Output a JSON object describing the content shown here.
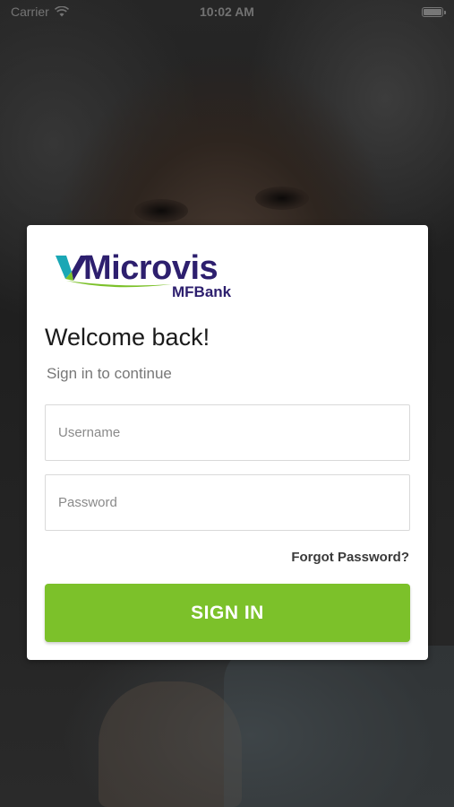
{
  "status_bar": {
    "carrier": "Carrier",
    "time": "10:02 AM",
    "wifi_icon": "wifi-icon",
    "battery_icon": "battery-icon"
  },
  "logo": {
    "name": "Microvis",
    "subname": "MFBank",
    "brand_color": "#2d1f6e",
    "accent_green": "#7cc12a",
    "accent_teal": "#1aa7b5"
  },
  "login": {
    "title": "Welcome back!",
    "subtitle": "Sign in to continue",
    "username_placeholder": "Username",
    "username_value": "",
    "password_placeholder": "Password",
    "password_value": "",
    "forgot_label": "Forgot Password?",
    "sign_in_label": "SIGN IN",
    "button_color": "#7cc12a"
  }
}
